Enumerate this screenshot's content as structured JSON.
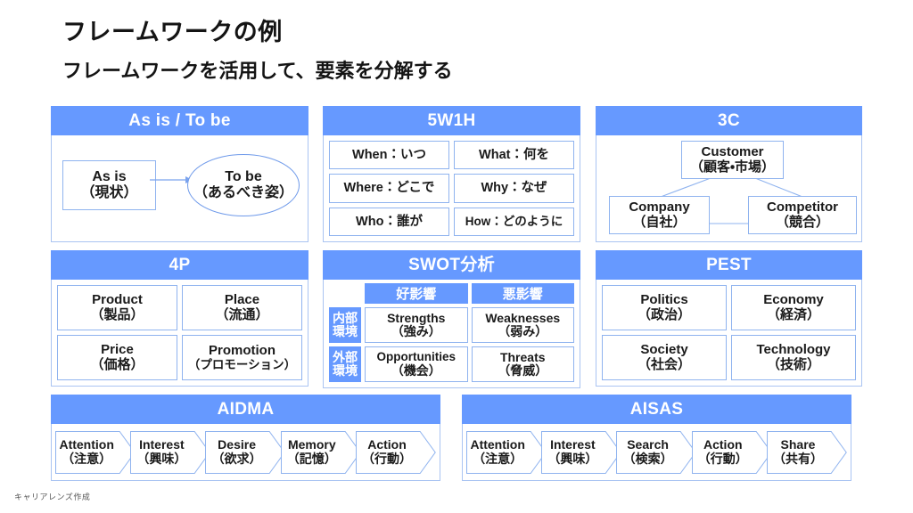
{
  "slide": {
    "title": "フレームワークの例",
    "subtitle": "フレームワークを活用して、要素を分解する",
    "credit": "キャリアレンズ作成",
    "accent_color": "#6699ff",
    "border_color": "#8fb3ef"
  },
  "panels": {
    "asis_tobe": {
      "header": "As is / To be",
      "asis": {
        "en": "As is",
        "jp": "（現状）"
      },
      "tobe": {
        "en": "To be",
        "jp": "（あるべき姿）"
      }
    },
    "w5h1": {
      "header": "5W1H",
      "cells": [
        "When：いつ",
        "What：何を",
        "Where：どこで",
        "Why：なぜ",
        "Who：誰が",
        "How：どのように"
      ]
    },
    "c3": {
      "header": "3C",
      "customer": {
        "en": "Customer",
        "jp": "（顧客・市場）"
      },
      "company": {
        "en": "Company",
        "jp": "（自社）"
      },
      "competitor": {
        "en": "Competitor",
        "jp": "（競合）"
      }
    },
    "p4": {
      "header": "4P",
      "cells": [
        {
          "en": "Product",
          "jp": "（製品）"
        },
        {
          "en": "Place",
          "jp": "（流通）"
        },
        {
          "en": "Price",
          "jp": "（価格）"
        },
        {
          "en": "Promotion",
          "jp": "（プロモーション）"
        }
      ]
    },
    "swot": {
      "header": "SWOT分析",
      "col_headers": [
        "好影響",
        "悪影響"
      ],
      "row_headers": [
        {
          "line1": "内部",
          "line2": "環境"
        },
        {
          "line1": "外部",
          "line2": "環境"
        }
      ],
      "cells": [
        {
          "en": "Strengths",
          "jp": "（強み）"
        },
        {
          "en": "Weaknesses",
          "jp": "（弱み）"
        },
        {
          "en": "Opportunities",
          "jp": "（機会）"
        },
        {
          "en": "Threats",
          "jp": "（脅威）"
        }
      ]
    },
    "pest": {
      "header": "PEST",
      "cells": [
        {
          "en": "Politics",
          "jp": "（政治）"
        },
        {
          "en": "Economy",
          "jp": "（経済）"
        },
        {
          "en": "Society",
          "jp": "（社会）"
        },
        {
          "en": "Technology",
          "jp": "（技術）"
        }
      ]
    },
    "aidma": {
      "header": "AIDMA",
      "steps": [
        {
          "en": "Attention",
          "jp": "（注意）"
        },
        {
          "en": "Interest",
          "jp": "（興味）"
        },
        {
          "en": "Desire",
          "jp": "（欲求）"
        },
        {
          "en": "Memory",
          "jp": "（記憶）"
        },
        {
          "en": "Action",
          "jp": "（行動）"
        }
      ]
    },
    "aisas": {
      "header": "AISAS",
      "steps": [
        {
          "en": "Attention",
          "jp": "（注意）"
        },
        {
          "en": "Interest",
          "jp": "（興味）"
        },
        {
          "en": "Search",
          "jp": "（検索）"
        },
        {
          "en": "Action",
          "jp": "（行動）"
        },
        {
          "en": "Share",
          "jp": "（共有）"
        }
      ]
    }
  }
}
